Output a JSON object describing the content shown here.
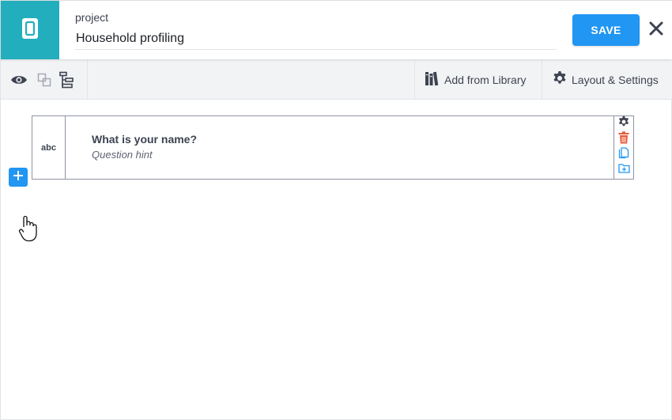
{
  "header": {
    "project_label": "project",
    "title_value": "Household profiling",
    "save_label": "SAVE",
    "logo_icon": "form-icon",
    "close_icon": "close-icon",
    "logo_color": "#22aebc"
  },
  "toolbar": {
    "icons": [
      "preview-eye-icon",
      "group-icon",
      "tree-structure-icon"
    ],
    "add_from_library_label": "Add from Library",
    "layout_settings_label": "Layout & Settings",
    "library_icon": "library-books-icon",
    "settings_icon": "gear-icon"
  },
  "question": {
    "type_label": "abc",
    "label": "What is your name?",
    "hint": "Question hint",
    "actions": [
      "gear-icon",
      "trash-icon",
      "duplicate-icon",
      "folder-add-icon"
    ]
  },
  "colors": {
    "accent": "#2196f3",
    "delete": "#e45c3e",
    "text": "#3d4350"
  }
}
